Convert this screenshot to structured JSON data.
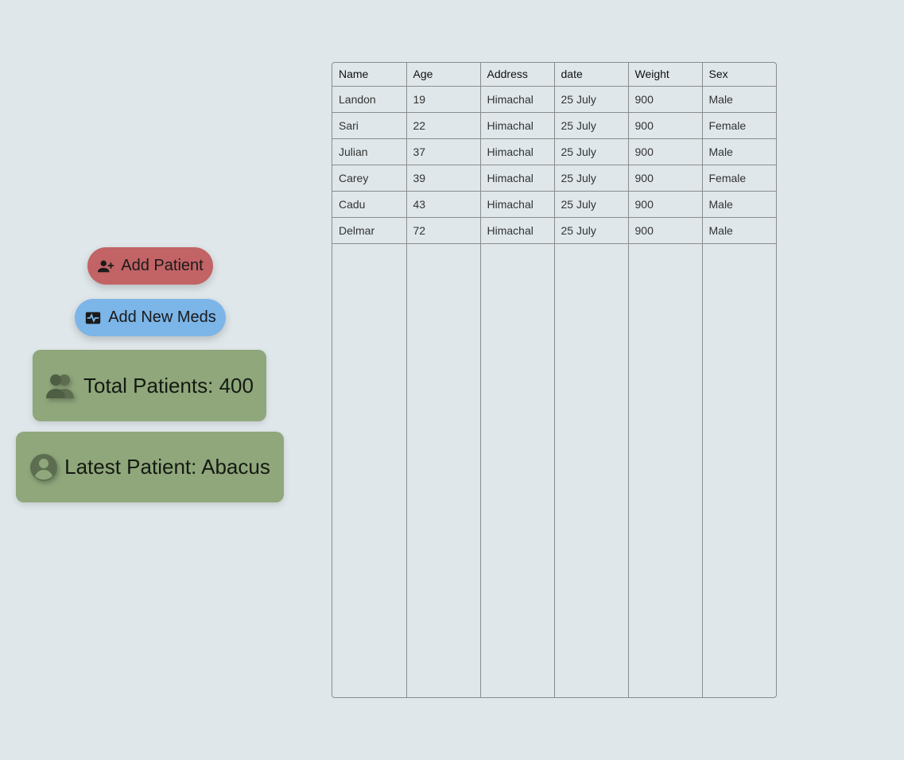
{
  "actions": {
    "add_patient_label": "Add Patient",
    "add_meds_label": "Add New Meds"
  },
  "stats": {
    "total_patients": "Total Patients: 400",
    "latest_patient": "Latest Patient: Abacus"
  },
  "table": {
    "headers": [
      "Name",
      "Age",
      "Address",
      "date",
      "Weight",
      "Sex"
    ],
    "rows": [
      [
        "Landon",
        "19",
        "Himachal",
        "25 July",
        "900",
        "Male"
      ],
      [
        "Sari",
        "22",
        "Himachal",
        "25 July",
        "900",
        "Female"
      ],
      [
        "Julian",
        "37",
        "Himachal",
        "25 July",
        "900",
        "Male"
      ],
      [
        "Carey",
        "39",
        "Himachal",
        "25 July",
        "900",
        "Female"
      ],
      [
        "Cadu",
        "43",
        "Himachal",
        "25 July",
        "900",
        "Male"
      ],
      [
        "Delmar",
        "72",
        "Himachal",
        "25 July",
        "900",
        "Male"
      ]
    ]
  },
  "colors": {
    "background": "#dfe7ea",
    "add_patient": "#c26365",
    "add_meds": "#7cb5e8",
    "stat_card": "#8fa77b"
  },
  "icons": {
    "add_patient": "person-add-icon",
    "add_meds": "monitor-heart-icon",
    "total_patients": "people-icon",
    "latest_patient": "account-circle-icon"
  }
}
